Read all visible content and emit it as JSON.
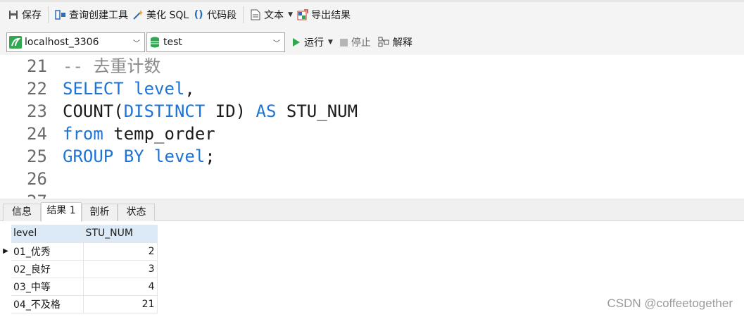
{
  "toolbar": {
    "save_label": "保存",
    "query_builder_label": "查询创建工具",
    "beautify_label": "美化 SQL",
    "snippet_label": "代码段",
    "text_label": "文本",
    "export_label": "导出结果"
  },
  "connection": {
    "server": "localhost_3306",
    "database": "test",
    "run_label": "运行",
    "stop_label": "停止",
    "explain_label": "解释"
  },
  "editor": {
    "lines": [
      {
        "num": "21",
        "tokens": [
          {
            "t": "-- 去重计数",
            "k": "cm"
          }
        ]
      },
      {
        "num": "22",
        "tokens": [
          {
            "t": "SELECT level",
            "k": "kw"
          },
          {
            "t": ",",
            "k": "tx"
          }
        ]
      },
      {
        "num": "23",
        "tokens": [
          {
            "t": "COUNT(",
            "k": "tx"
          },
          {
            "t": "DISTINCT",
            "k": "kw"
          },
          {
            "t": " ID) ",
            "k": "tx"
          },
          {
            "t": "AS",
            "k": "kw"
          },
          {
            "t": " STU_NUM",
            "k": "tx"
          }
        ]
      },
      {
        "num": "24",
        "tokens": [
          {
            "t": "from",
            "k": "kw"
          },
          {
            "t": " temp_order",
            "k": "tx"
          }
        ]
      },
      {
        "num": "25",
        "tokens": [
          {
            "t": "GROUP BY level",
            "k": "kw"
          },
          {
            "t": ";",
            "k": "tx"
          }
        ]
      },
      {
        "num": "26",
        "tokens": []
      },
      {
        "num": "27",
        "tokens": []
      }
    ]
  },
  "tabs": [
    {
      "label": "信息"
    },
    {
      "label": "结果 1"
    },
    {
      "label": "剖析"
    },
    {
      "label": "状态"
    }
  ],
  "results": {
    "columns": [
      "level",
      "STU_NUM"
    ],
    "rows": [
      [
        "01_优秀",
        "2"
      ],
      [
        "02_良好",
        "3"
      ],
      [
        "03_中等",
        "4"
      ],
      [
        "04_不及格",
        "21"
      ]
    ]
  },
  "watermark": "CSDN @coffeetogether",
  "colors": {
    "keyword": "#1e74d6",
    "comment": "#8a8a8a",
    "header_bg": "#dce9f6",
    "run_green": "#2fa84f"
  }
}
